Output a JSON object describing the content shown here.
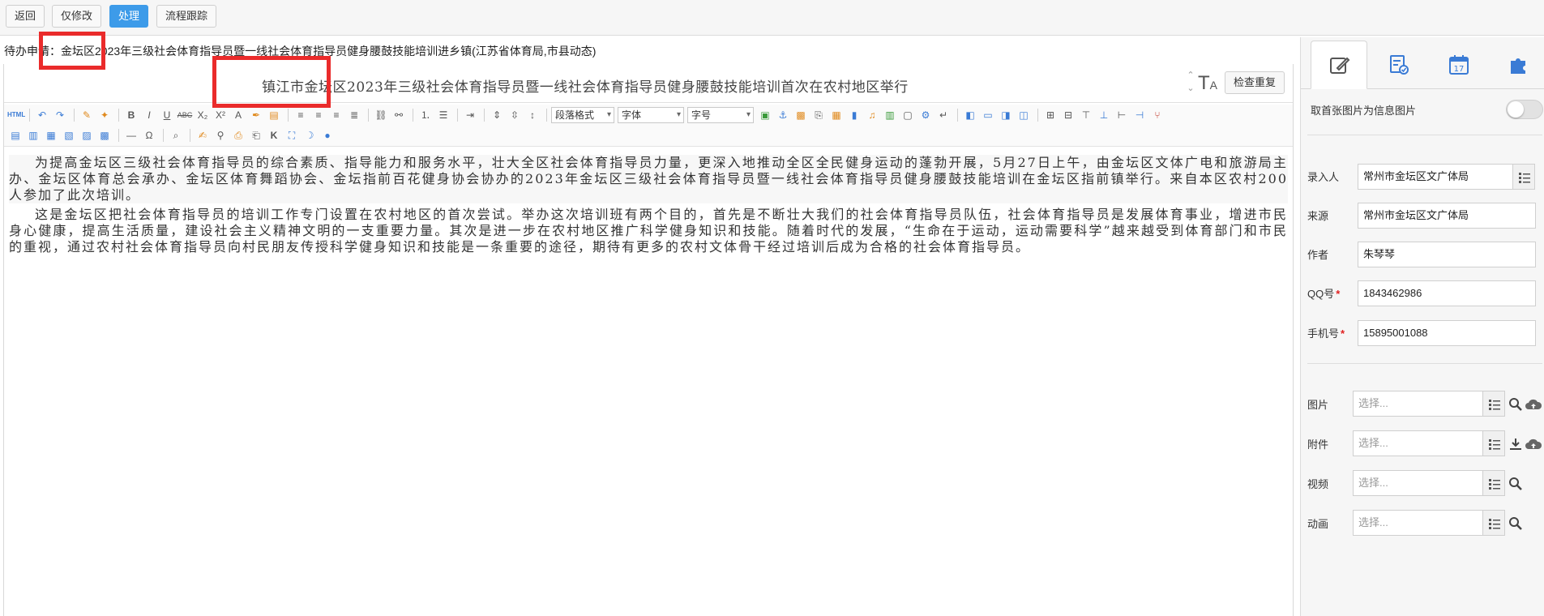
{
  "toolbar": {
    "back": "返回",
    "modify_only": "仅修改",
    "process": "处理",
    "flow_trace": "流程跟踪"
  },
  "todo_line": "待办申请：金坛区2023年三级社会体育指导员暨一线社会体育指导员健身腰鼓技能培训进乡镇(江苏省体育局,市县动态)",
  "editor": {
    "title": "镇江市金坛区2023年三级社会体育指导员暨一线社会体育指导员健身腰鼓技能培训首次在农村地区举行",
    "font_size_icon": "font-size-icon",
    "check_duplicate": "检查重复",
    "toolbar": {
      "html_label": "HTML",
      "paragraph_format": "段落格式",
      "font_family": "字体",
      "font_size": "字号",
      "bold": "B",
      "italic": "I",
      "underline": "U",
      "strike": "ABC",
      "subscript": "X₂",
      "superscript": "X²",
      "font_color": "A",
      "omega": "Ω",
      "k": "K"
    },
    "paragraphs": [
      "为提高金坛区三级社会体育指导员的综合素质、指导能力和服务水平，壮大全区社会体育指导员力量，更深入地推动全区全民健身运动的蓬勃开展，5月27日上午，由金坛区文体广电和旅游局主办、金坛区体育总会承办、金坛区体育舞蹈协会、金坛指前百花健身协会协办的2023年金坛区三级社会体育指导员暨一线社会体育指导员健身腰鼓技能培训在金坛区指前镇举行。来自本区农村200人参加了此次培训。",
      "这是金坛区把社会体育指导员的培训工作专门设置在农村地区的首次尝试。举办这次培训班有两个目的，首先是不断壮大我们的社会体育指导员队伍，社会体育指导员是发展体育事业，增进市民身心健康，提高生活质量，建设社会主义精神文明的一支重要力量。其次是进一步在农村地区推广科学健身知识和技能。随着时代的发展，“生命在于运动，运动需要科学”越来越受到体育部门和市民的重视，通过农村社会体育指导员向村民朋友传授科学健身知识和技能是一条重要的途径，期待有更多的农村文体骨干经过培训后成为合格的社会体育指导员。"
    ]
  },
  "highlight_color": "#ea2b2b",
  "accent_color": "#3d9be9",
  "right_panel": {
    "tabs": [
      {
        "icon": "edit-icon"
      },
      {
        "icon": "checklist-icon"
      },
      {
        "icon": "calendar-icon",
        "label": "17"
      },
      {
        "icon": "puzzle-icon"
      }
    ],
    "first_image_toggle": "取首张图片为信息图片",
    "toggle_on": false,
    "fields": {
      "entry_person": {
        "label": "录入人",
        "value": "常州市金坛区文广体局"
      },
      "source": {
        "label": "来源",
        "value": "常州市金坛区文广体局"
      },
      "author": {
        "label": "作者",
        "value": "朱琴琴"
      },
      "qq": {
        "label": "QQ号",
        "value": "1843462986"
      },
      "mobile": {
        "label": "手机号",
        "value": "15895001088"
      }
    },
    "media": {
      "image": {
        "label": "图片",
        "placeholder": "选择..."
      },
      "attachment": {
        "label": "附件",
        "placeholder": "选择..."
      },
      "video": {
        "label": "视频",
        "placeholder": "选择..."
      },
      "animation": {
        "label": "动画",
        "placeholder": "选择..."
      }
    }
  }
}
